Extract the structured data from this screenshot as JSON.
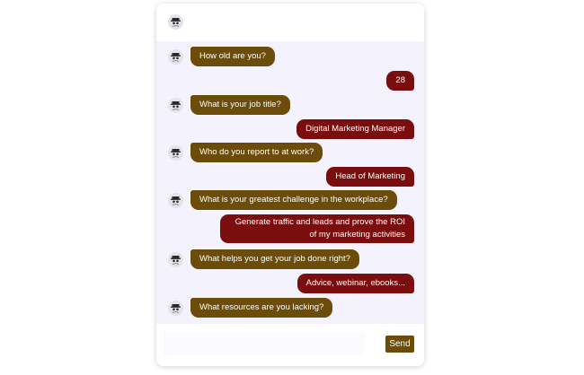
{
  "chat": {
    "bot_avatar_icon": "bot-avatar-icon",
    "messages": [
      {
        "sender": "bot",
        "text": "How old are you?"
      },
      {
        "sender": "user",
        "text": "28"
      },
      {
        "sender": "bot",
        "text": "What is your job title?"
      },
      {
        "sender": "user",
        "text": "Digital Marketing Manager"
      },
      {
        "sender": "bot",
        "text": "Who do you report to at work?"
      },
      {
        "sender": "user",
        "text": "Head of Marketing"
      },
      {
        "sender": "bot",
        "text": "What is your greatest challenge in the workplace?"
      },
      {
        "sender": "user",
        "text": "Generate traffic and leads and prove the ROI of my marketing activities"
      },
      {
        "sender": "bot",
        "text": "What helps you get your job done right?"
      },
      {
        "sender": "user",
        "text": "Advice, webinar, ebooks..."
      },
      {
        "sender": "bot",
        "text": "What resources are you lacking?"
      }
    ]
  },
  "composer": {
    "input_value": "",
    "send_label": "Send"
  },
  "colors": {
    "bot_bubble": "#6b4c09",
    "user_bubble": "#7a0d0d",
    "chat_background": "#f4f2fc"
  }
}
